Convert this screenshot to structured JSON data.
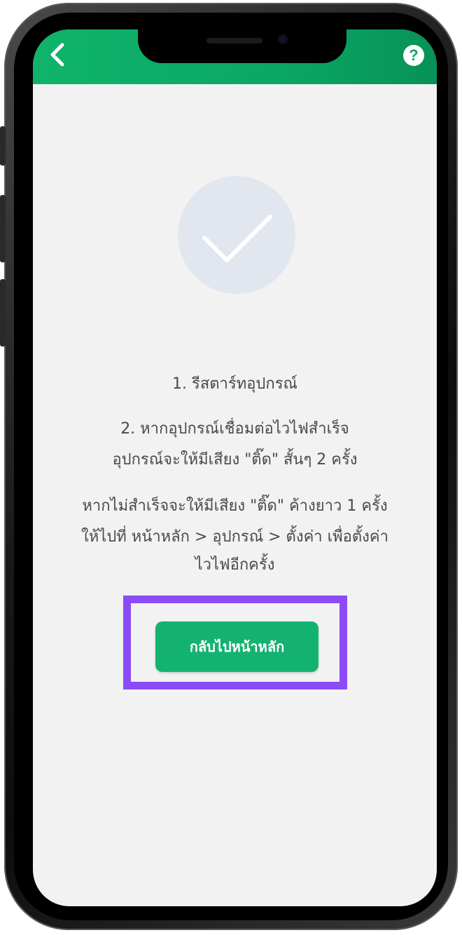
{
  "app_bar": {
    "back_icon": "chevron-left-icon",
    "help_icon": "question-mark-icon",
    "help_label": "?",
    "color": "#0aa764"
  },
  "status": {
    "icon": "check-icon"
  },
  "instructions": {
    "step1": "1. รีสตาร์ทอุปกรณ์",
    "step2_line1": "2. หากอุปกรณ์เชื่อมต่อไวไฟสำเร็จ",
    "step2_line2": "อุปกรณ์จะให้มีเสียง \"ติ๊ด\" สั้นๆ 2 ครั้ง",
    "fail_line1": "หากไม่สำเร็จจะให้มีเสียง \"ติ๊ด\" ค้างยาว 1 ครั้ง",
    "fail_line2": "ให้ไปที่ หน้าหลัก > อุปกรณ์ > ตั้งค่า เพื่อตั้งค่า",
    "fail_line3": "ไวไฟอีกครั้ง"
  },
  "actions": {
    "back_home_label": "กลับไปหน้าหลัก",
    "button_color": "#14b270",
    "highlight_color": "#8b4cf6"
  }
}
